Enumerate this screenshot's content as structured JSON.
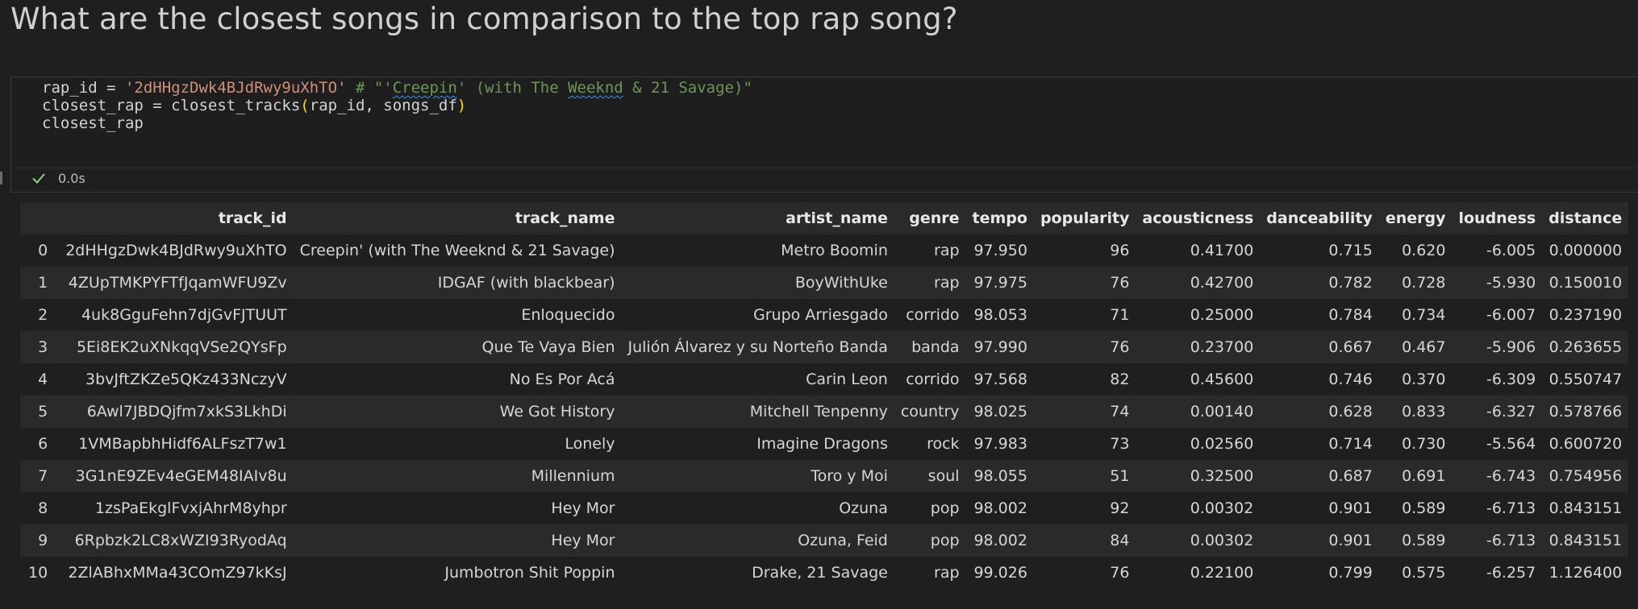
{
  "heading": "What are the closest songs in comparison to the top rap song?",
  "code": {
    "line1": {
      "var": "rap_id",
      "op": " = ",
      "str": "'2dHHgzDwk4BJdRwy9uXhTO'",
      "space": " ",
      "comment_prefix": "# \"'",
      "comment_word": "Creepin",
      "comment_mid": "' (with The ",
      "comment_word2": "Weeknd",
      "comment_suffix": " & 21 Savage)\""
    },
    "line2": {
      "lhs": "closest_rap = closest_tracks",
      "open": "(",
      "args": "rap_id, songs_df",
      "close": ")"
    },
    "line3": "closest_rap"
  },
  "status": {
    "icon": "check-icon",
    "time": "0.0s",
    "color": "#89d185"
  },
  "table": {
    "columns": [
      "",
      "track_id",
      "track_name",
      "artist_name",
      "genre",
      "tempo",
      "popularity",
      "acousticness",
      "danceability",
      "energy",
      "loudness",
      "distance"
    ],
    "rows": [
      [
        "0",
        "2dHHgzDwk4BJdRwy9uXhTO",
        "Creepin' (with The Weeknd & 21 Savage)",
        "Metro Boomin",
        "rap",
        "97.950",
        "96",
        "0.41700",
        "0.715",
        "0.620",
        "-6.005",
        "0.000000"
      ],
      [
        "1",
        "4ZUpTMKPYFTfJqamWFU9Zv",
        "IDGAF (with blackbear)",
        "BoyWithUke",
        "rap",
        "97.975",
        "76",
        "0.42700",
        "0.782",
        "0.728",
        "-5.930",
        "0.150010"
      ],
      [
        "2",
        "4uk8GguFehn7djGvFJTUUT",
        "Enloquecido",
        "Grupo Arriesgado",
        "corrido",
        "98.053",
        "71",
        "0.25000",
        "0.784",
        "0.734",
        "-6.007",
        "0.237190"
      ],
      [
        "3",
        "5Ei8EK2uXNkqqVSe2QYsFp",
        "Que Te Vaya Bien",
        "Julión Álvarez y su Norteño Banda",
        "banda",
        "97.990",
        "76",
        "0.23700",
        "0.667",
        "0.467",
        "-5.906",
        "0.263655"
      ],
      [
        "4",
        "3bvJftZKZe5QKz433NczyV",
        "No Es Por Acá",
        "Carin Leon",
        "corrido",
        "97.568",
        "82",
        "0.45600",
        "0.746",
        "0.370",
        "-6.309",
        "0.550747"
      ],
      [
        "5",
        "6Awl7JBDQjfm7xkS3LkhDi",
        "We Got History",
        "Mitchell Tenpenny",
        "country",
        "98.025",
        "74",
        "0.00140",
        "0.628",
        "0.833",
        "-6.327",
        "0.578766"
      ],
      [
        "6",
        "1VMBapbhHidf6ALFszT7w1",
        "Lonely",
        "Imagine Dragons",
        "rock",
        "97.983",
        "73",
        "0.02560",
        "0.714",
        "0.730",
        "-5.564",
        "0.600720"
      ],
      [
        "7",
        "3G1nE9ZEv4eGEM48IAIv8u",
        "Millennium",
        "Toro y Moi",
        "soul",
        "98.055",
        "51",
        "0.32500",
        "0.687",
        "0.691",
        "-6.743",
        "0.754956"
      ],
      [
        "8",
        "1zsPaEkglFvxjAhrM8yhpr",
        "Hey Mor",
        "Ozuna",
        "pop",
        "98.002",
        "92",
        "0.00302",
        "0.901",
        "0.589",
        "-6.713",
        "0.843151"
      ],
      [
        "9",
        "6Rpbzk2LC8xWZI93RyodAq",
        "Hey Mor",
        "Ozuna, Feid",
        "pop",
        "98.002",
        "84",
        "0.00302",
        "0.901",
        "0.589",
        "-6.713",
        "0.843151"
      ],
      [
        "10",
        "2ZlABhxMMa43COmZ97kKsJ",
        "Jumbotron Shit Poppin",
        "Drake, 21 Savage",
        "rap",
        "99.026",
        "76",
        "0.22100",
        "0.799",
        "0.575",
        "-6.257",
        "1.126400"
      ]
    ]
  }
}
